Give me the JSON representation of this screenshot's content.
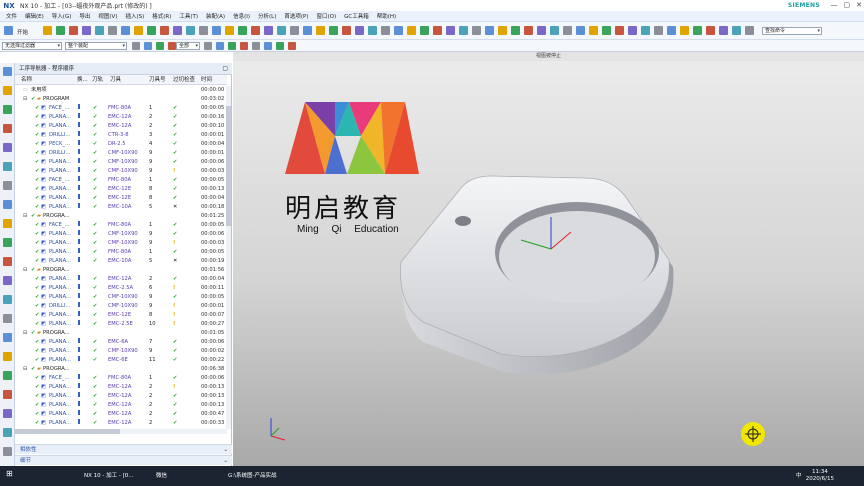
{
  "window": {
    "app_icon": "NX",
    "title": "NX 10 - 加工 - [03--蝠夜外观产品.prt  (修改的) ]",
    "brand": "SIEMENS"
  },
  "menu": [
    "文件",
    "编辑(E)",
    "导入(G)",
    "导出",
    "视图(V)",
    "插入(S)",
    "格式(R)",
    "工具(T)",
    "装配(A)",
    "信息(I)",
    "分析(L)",
    "首选项(P)",
    "窗口(O)",
    "GC工具箱",
    "帮助(H)"
  ],
  "toolbar": {
    "filter_dropdown": "无选择过滤器",
    "assembly_dropdown": "整个装配",
    "scope_dropdown": "全部",
    "search_placeholder": "查找命令",
    "start_label": "开始"
  },
  "navigator": {
    "title": "工序导航器 - 程序顺序",
    "columns": [
      "名称",
      "换...",
      "刀轨",
      "刀具",
      "刀具号",
      "过切检查",
      "时间"
    ],
    "rows": [
      {
        "name": "未用项",
        "tool": "",
        "no": "",
        "check": "",
        "time": "00:00:00",
        "level": 0
      },
      {
        "name": "PROGRAM",
        "tool": "",
        "no": "",
        "check": "",
        "time": "00:03:02",
        "level": 1
      },
      {
        "name": "FACE_...",
        "tool": "FMC-80A",
        "no": "1",
        "check": "ok",
        "time": "00:00:05",
        "level": 2
      },
      {
        "name": "PLANA...",
        "tool": "EMC-12A",
        "no": "2",
        "check": "ok",
        "time": "00:00:16",
        "level": 2
      },
      {
        "name": "PLANA...",
        "tool": "EMC-12A",
        "no": "2",
        "check": "ok",
        "time": "00:00:10",
        "level": 2
      },
      {
        "name": "DRILLI...",
        "tool": "CTR-3-8",
        "no": "3",
        "check": "ok",
        "time": "00:00:01",
        "level": 2
      },
      {
        "name": "PECK_...",
        "tool": "DR-2.5",
        "no": "4",
        "check": "ok",
        "time": "00:00:04",
        "level": 2
      },
      {
        "name": "DRILLI...",
        "tool": "CMF-10X90",
        "no": "9",
        "check": "ok",
        "time": "00:00:01",
        "level": 2
      },
      {
        "name": "PLANA...",
        "tool": "CMF-10X90",
        "no": "9",
        "check": "ok",
        "time": "00:00:06",
        "level": 2
      },
      {
        "name": "PLANA...",
        "tool": "CMF-10X90",
        "no": "9",
        "check": "warn",
        "time": "00:00:03",
        "level": 2
      },
      {
        "name": "FACE_...",
        "tool": "FMC-80A",
        "no": "1",
        "check": "ok",
        "time": "00:00:05",
        "level": 2
      },
      {
        "name": "PLANA...",
        "tool": "EMC-12E",
        "no": "8",
        "check": "ok",
        "time": "00:00:13",
        "level": 2
      },
      {
        "name": "PLANA...",
        "tool": "EMC-12E",
        "no": "8",
        "check": "ok",
        "time": "00:00:04",
        "level": 2
      },
      {
        "name": "PLANA...",
        "tool": "EMC-10A",
        "no": "5",
        "check": "x",
        "time": "00:00:18",
        "level": 2
      },
      {
        "name": "PROGRA...",
        "tool": "",
        "no": "",
        "check": "",
        "time": "00:01:25",
        "level": 1
      },
      {
        "name": "FACE_...",
        "tool": "FMC-80A",
        "no": "1",
        "check": "ok",
        "time": "00:00:05",
        "level": 2
      },
      {
        "name": "PLANA...",
        "tool": "CMF-10X90",
        "no": "9",
        "check": "ok",
        "time": "00:00:06",
        "level": 2
      },
      {
        "name": "PLANA...",
        "tool": "CMF-10X90",
        "no": "9",
        "check": "warn",
        "time": "00:00:03",
        "level": 2
      },
      {
        "name": "PLANA...",
        "tool": "FMC-80A",
        "no": "1",
        "check": "ok",
        "time": "00:00:05",
        "level": 2
      },
      {
        "name": "PLANA...",
        "tool": "EMC-10A",
        "no": "5",
        "check": "x",
        "time": "00:00:19",
        "level": 2
      },
      {
        "name": "PROGRA...",
        "tool": "",
        "no": "",
        "check": "",
        "time": "00:01:56",
        "level": 1
      },
      {
        "name": "PLANA...",
        "tool": "EMC-12A",
        "no": "2",
        "check": "ok",
        "time": "00:00:04",
        "level": 2
      },
      {
        "name": "PLANA...",
        "tool": "EMC-2.5A",
        "no": "6",
        "check": "warn",
        "time": "00:00:11",
        "level": 2
      },
      {
        "name": "PLANA...",
        "tool": "CMF-10X90",
        "no": "9",
        "check": "ok",
        "time": "00:00:05",
        "level": 2
      },
      {
        "name": "DRILLI...",
        "tool": "CMF-10X90",
        "no": "9",
        "check": "warn",
        "time": "00:00:01",
        "level": 2
      },
      {
        "name": "PLANA...",
        "tool": "EMC-12E",
        "no": "8",
        "check": "warn",
        "time": "00:00:07",
        "level": 2
      },
      {
        "name": "PLANA...",
        "tool": "EMC-2.5E",
        "no": "10",
        "check": "warn",
        "time": "00:00:27",
        "level": 2
      },
      {
        "name": "PROGRA...",
        "tool": "",
        "no": "",
        "check": "",
        "time": "00:01:05",
        "level": 1
      },
      {
        "name": "PLANA...",
        "tool": "EMC-6A",
        "no": "7",
        "check": "ok",
        "time": "00:00:06",
        "level": 2
      },
      {
        "name": "PLANA...",
        "tool": "CMF-10X90",
        "no": "9",
        "check": "ok",
        "time": "00:00:02",
        "level": 2
      },
      {
        "name": "PLANA...",
        "tool": "EMC-6E",
        "no": "11",
        "check": "ok",
        "time": "00:00:22",
        "level": 2
      },
      {
        "name": "PROGRA...",
        "tool": "",
        "no": "",
        "check": "",
        "time": "00:06:38",
        "level": 1
      },
      {
        "name": "FACE_...",
        "tool": "FMC-80A",
        "no": "1",
        "check": "ok",
        "time": "00:00:06",
        "level": 2
      },
      {
        "name": "PLANA...",
        "tool": "EMC-12A",
        "no": "2",
        "check": "warn",
        "time": "00:00:13",
        "level": 2
      },
      {
        "name": "PLANA...",
        "tool": "EMC-12A",
        "no": "2",
        "check": "ok",
        "time": "00:00:13",
        "level": 2
      },
      {
        "name": "PLANA...",
        "tool": "EMC-12A",
        "no": "2",
        "check": "ok",
        "time": "00:00:13",
        "level": 2
      },
      {
        "name": "PLANA...",
        "tool": "EMC-12A",
        "no": "2",
        "check": "ok",
        "time": "00:00:47",
        "level": 2
      },
      {
        "name": "PLANA...",
        "tool": "EMC-12A",
        "no": "2",
        "check": "ok",
        "time": "00:00:33",
        "level": 2
      }
    ],
    "section_labels": [
      "相依性",
      "细节"
    ]
  },
  "viewport": {
    "header": "视图被停止",
    "brand_cn": "明启教育",
    "brand_en": "Ming Qi  Education"
  },
  "taskbar": {
    "items": [
      "NX 10 - 加工 - [0...",
      "微信",
      "G:\\系统图-产品实战"
    ],
    "time": "11:34",
    "date": "2020/6/15",
    "ime": "中"
  },
  "colors": {
    "accent": "#1b4f9c",
    "brand_teal": "#1aa0a0",
    "ok_green": "#17a533",
    "warn_yellow": "#e0a400"
  }
}
